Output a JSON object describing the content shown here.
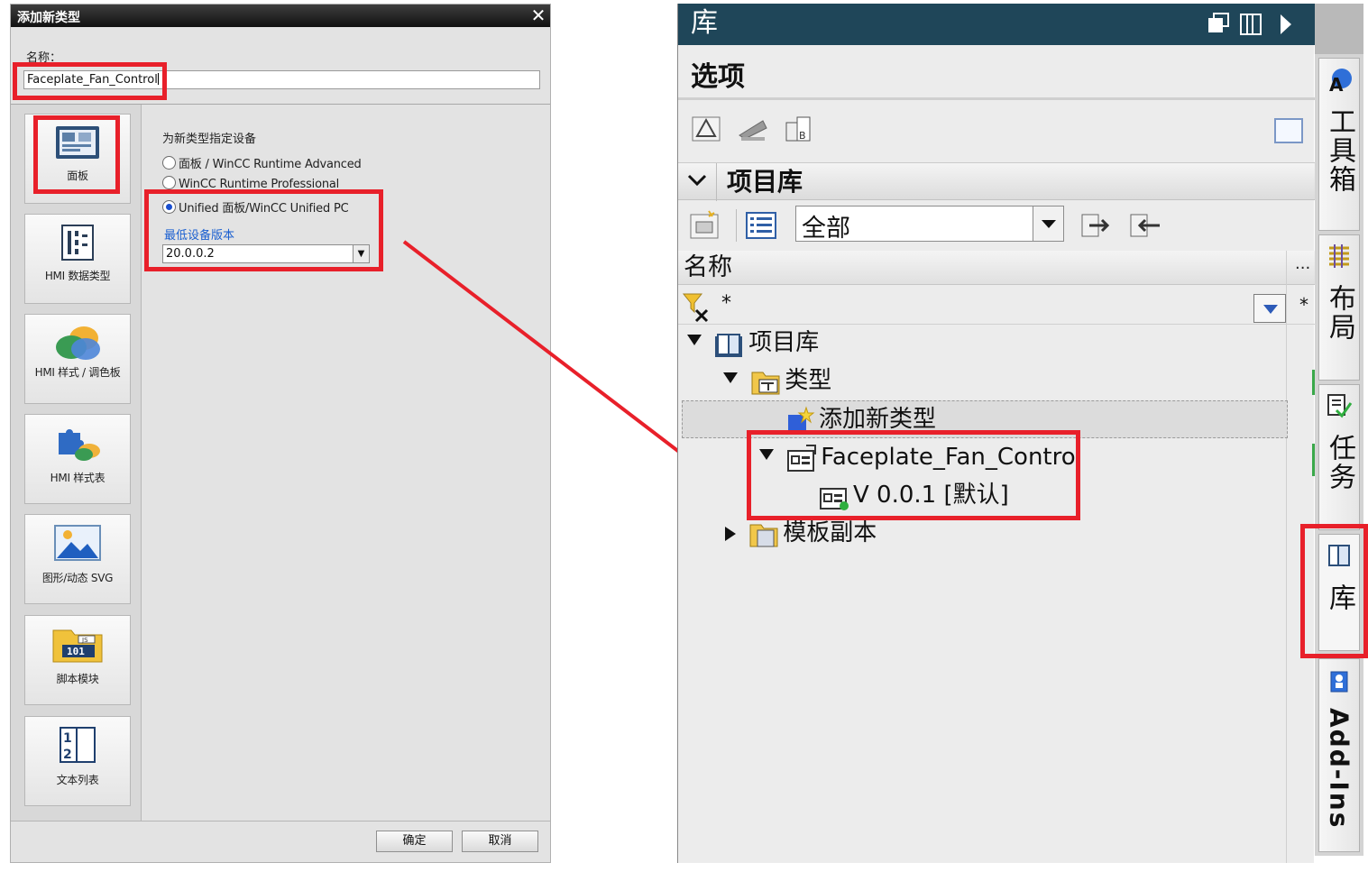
{
  "dialog": {
    "title": "添加新类型",
    "close_glyph": "✕",
    "name_label": "名称：",
    "name_value": "Faceplate_Fan_Control",
    "categories": [
      {
        "label": "面板"
      },
      {
        "label": "HMI 数据类型"
      },
      {
        "label": "HMI 样式 / 调色板"
      },
      {
        "label": "HMI 样式表"
      },
      {
        "label": "图形/动态 SVG"
      },
      {
        "label": "脚本模块"
      },
      {
        "label": "文本列表"
      }
    ],
    "assign_label": "为新类型指定设备",
    "device_options": [
      {
        "label": "面板 / WinCC Runtime Advanced",
        "selected": false
      },
      {
        "label": "WinCC Runtime Professional",
        "selected": false
      },
      {
        "label": "Unified 面板/WinCC Unified PC",
        "selected": true
      }
    ],
    "min_version_label": "最低设备版本",
    "min_version_value": "20.0.0.2",
    "ok_label": "确定",
    "cancel_label": "取消"
  },
  "library": {
    "title": "库",
    "options_title": "选项",
    "project_library_title": "项目库",
    "filter_value": "全部",
    "column_name": "名称",
    "column_more": "...",
    "filter_text": "*",
    "tree": [
      {
        "label": "项目库",
        "expanded": true
      },
      {
        "label": "类型",
        "expanded": true
      },
      {
        "label": "添加新类型"
      },
      {
        "label": "Faceplate_Fan_Control",
        "expanded": true
      },
      {
        "label": "V 0.0.1 [默认]"
      },
      {
        "label": "模板副本",
        "expanded": false
      }
    ]
  },
  "side_tabs": [
    {
      "label": "工具箱",
      "icon": "toolbox-icon"
    },
    {
      "label": "布局",
      "icon": "layout-icon"
    },
    {
      "label": "任务",
      "icon": "tasks-icon"
    },
    {
      "label": "库",
      "icon": "library-book-icon",
      "active": true
    },
    {
      "label": "Add-Ins",
      "icon": "addins-icon"
    }
  ],
  "colors": {
    "highlight": "#e8202a",
    "header_bar": "#1f4659",
    "accent_blue": "#1a5fd0"
  }
}
